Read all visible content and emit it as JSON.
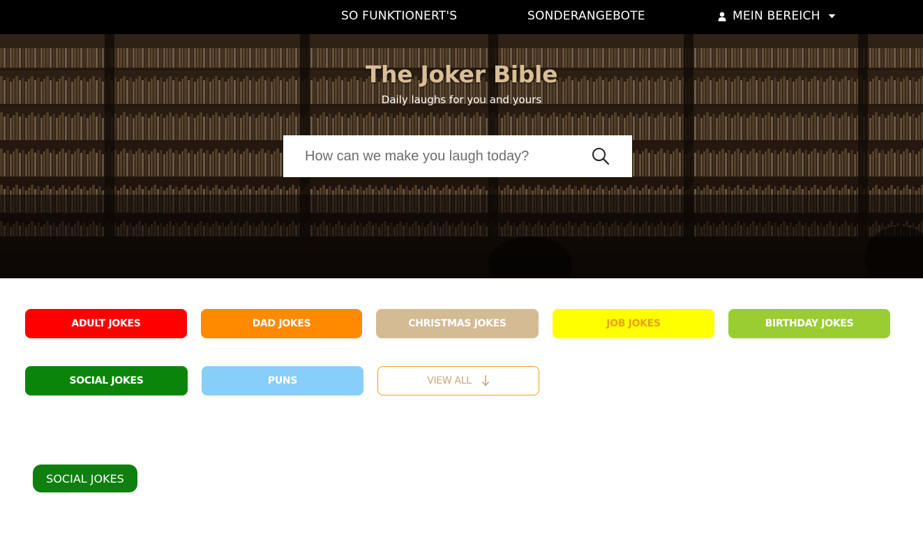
{
  "nav": {
    "how_it_works": "SO FUNKTIONERT'S",
    "offers": "SONDERANGEBOTE",
    "account": "MEIN BEREICH",
    "account_icon": "user-icon",
    "account_caret": "caret-down-icon"
  },
  "hero": {
    "title": "The Joker Bible",
    "subtitle": "Daily laughs for you and yours",
    "search_placeholder": "How can we make you laugh today?",
    "search_icon": "search-icon"
  },
  "categories": [
    {
      "label": "ADULT JOKES",
      "color": "#ff0000",
      "text_color": "#ffffff"
    },
    {
      "label": "DAD JOKES",
      "color": "#ff8a00",
      "text_color": "#ffffff"
    },
    {
      "label": "CHRISTMAS JOKES",
      "color": "#d4bb94",
      "text_color": "#ffffff"
    },
    {
      "label": "JOB JOKES",
      "color": "#ffff00",
      "text_color": "#e8a318"
    },
    {
      "label": "BIRTHDAY JOKES",
      "color": "#9acd32",
      "text_color": "#ffffff"
    },
    {
      "label": "SOCIAL JOKES",
      "color": "#0a850a",
      "text_color": "#ffffff"
    },
    {
      "label": "PUNS",
      "color": "#87cefa",
      "text_color": "#ffffff"
    }
  ],
  "view_all": {
    "label": "VIEW ALL",
    "icon": "arrow-down-icon",
    "border_color": "#e8a318"
  },
  "active_tag": {
    "label": "SOCIAL JOKES",
    "color": "#0f7f0f"
  }
}
